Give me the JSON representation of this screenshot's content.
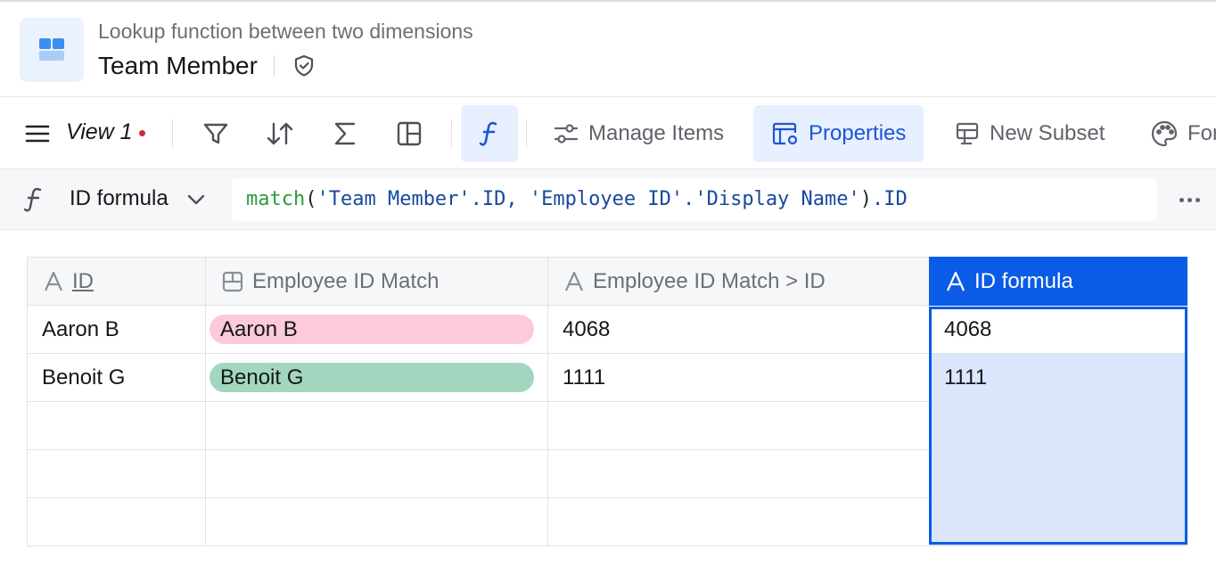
{
  "header": {
    "subtitle": "Lookup function between two dimensions",
    "title": "Team Member"
  },
  "toolbar": {
    "view_label": "View 1",
    "manage_items": "Manage Items",
    "properties": "Properties",
    "new_subset": "New Subset",
    "format": "For"
  },
  "formula_bar": {
    "name": "ID formula",
    "tokens": {
      "fn": "match",
      "open": "(",
      "arg1a": "'Team Member'",
      "arg1b": ".ID, ",
      "arg2a": "'Employee ID'",
      "arg2b": ".",
      "arg2c": "'Display Name'",
      "close": ")",
      "tail": ".ID"
    }
  },
  "grid": {
    "columns": [
      "ID",
      "Employee ID Match",
      "Employee ID Match > ID",
      "ID formula"
    ],
    "rows": [
      {
        "id": "Aaron B",
        "match": "Aaron B",
        "match_id": "4068",
        "formula": "4068"
      },
      {
        "id": "Benoit G",
        "match": "Benoit G",
        "match_id": "1111",
        "formula": "1111"
      }
    ]
  },
  "colors": {
    "accent": "#0a5ce6",
    "pill_pink": "#fccadb",
    "pill_green": "#a3d6be",
    "selection_fill": "#dbe5fc",
    "status_dot": "#d3283b"
  },
  "icons": {
    "app": "dimension-icon",
    "security": "shield-icon",
    "menu": "hamburger-icon",
    "filter": "filter-icon",
    "sort": "sort-icon",
    "sum": "sigma-icon",
    "layout": "layout-icon",
    "formula": "function-icon",
    "more": "more-icon"
  }
}
